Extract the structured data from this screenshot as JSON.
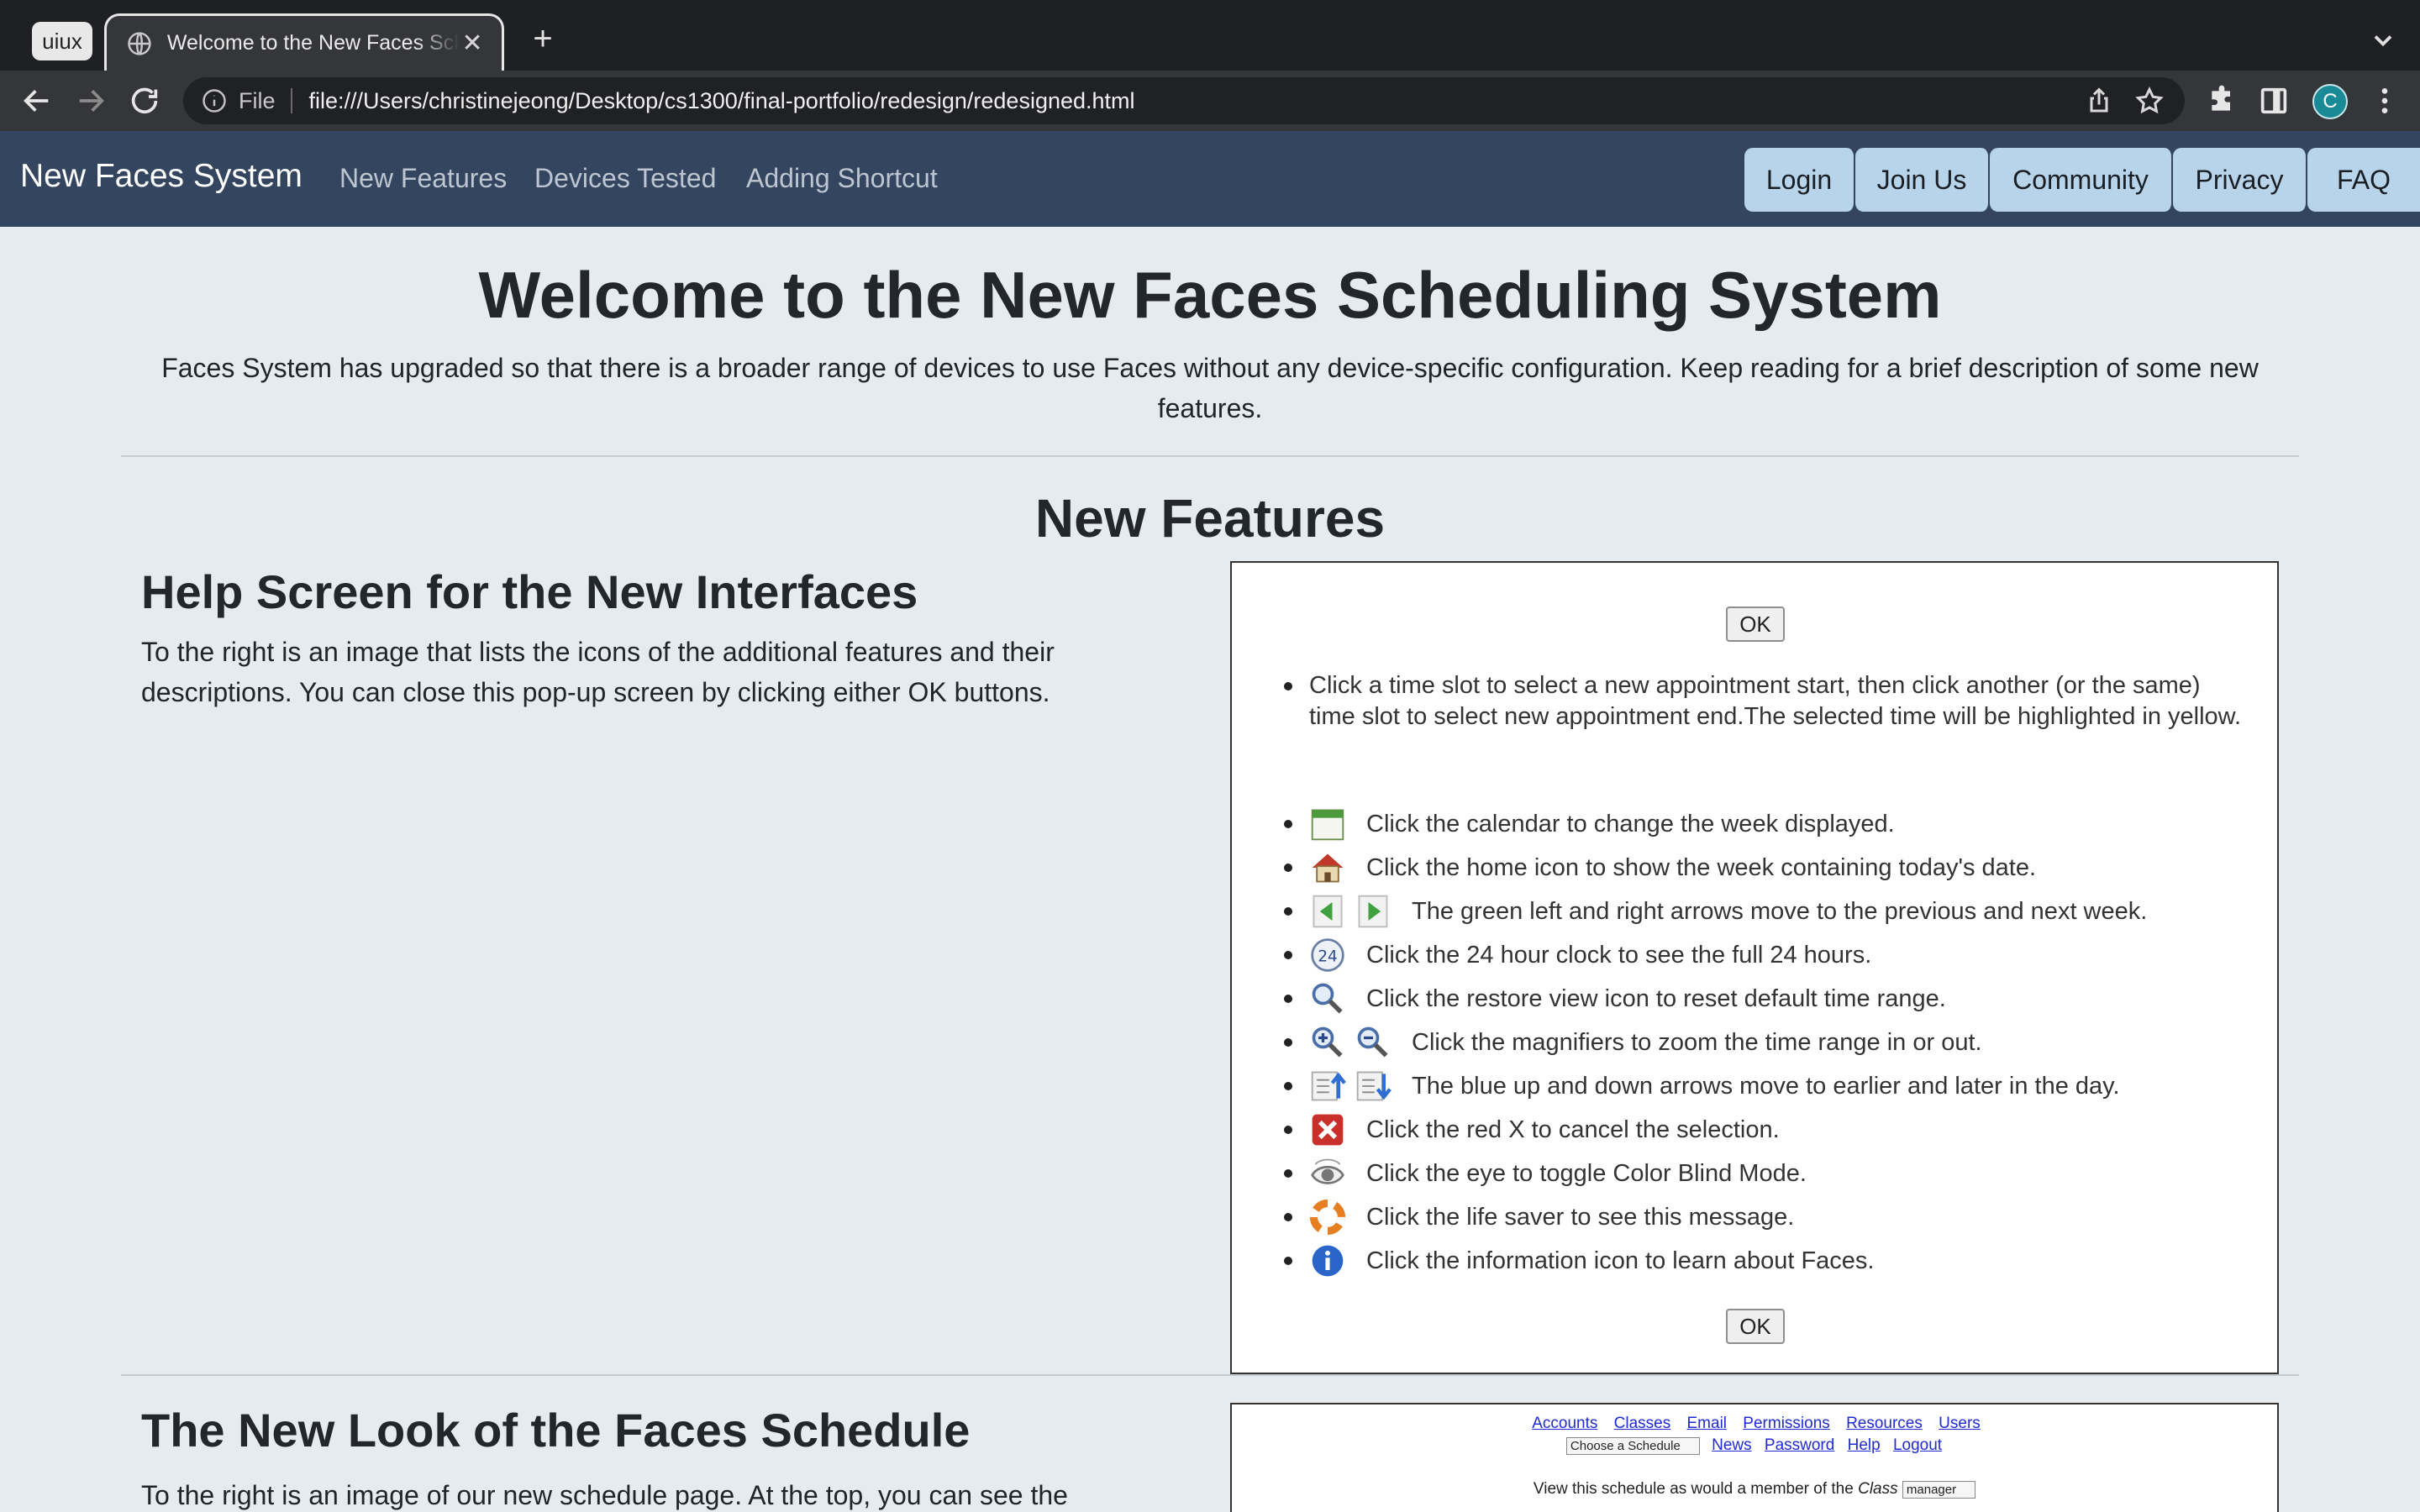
{
  "browser": {
    "profile_label": "uiux",
    "tab_title": "Welcome to the New Faces Scheduling System",
    "url_scheme": "File",
    "url": "file:///Users/christinejeong/Desktop/cs1300/final-portfolio/redesign/redesigned.html",
    "avatar_letter": "C"
  },
  "navbar": {
    "brand": "New Faces System",
    "links": [
      "New Features",
      "Devices Tested",
      "Adding Shortcut"
    ],
    "buttons": [
      "Login",
      "Join Us",
      "Community",
      "Privacy",
      "FAQ"
    ]
  },
  "hero": {
    "title": "Welcome to the New Faces Scheduling System",
    "subtitle": "Faces System has upgraded so that there is a broader range of devices to use Faces without any device-specific configuration. Keep reading for a brief description of some new features."
  },
  "new_features": {
    "heading": "New Features",
    "help": {
      "title": "Help Screen for the New Interfaces",
      "text": "To the right is an image that lists the icons of the additional features and their descriptions. You can close this pop-up screen by clicking either OK buttons.",
      "image": {
        "ok_label": "OK",
        "intro": "Click a time slot to select a new appointment start, then click another (or the same) time slot to select new appointment end.The selected time will be highlighted in yellow.",
        "items": [
          {
            "icons": [
              "calendar-icon"
            ],
            "text": "Click the calendar to change the week displayed."
          },
          {
            "icons": [
              "home-icon"
            ],
            "text": "Click the home icon to show the week containing today's date."
          },
          {
            "icons": [
              "arrow-left-icon",
              "arrow-right-icon"
            ],
            "text": "The green left and right arrows move to the previous and next week."
          },
          {
            "icons": [
              "clock-24-icon"
            ],
            "text": "Click the 24 hour clock to see the full 24 hours."
          },
          {
            "icons": [
              "restore-magnifier-icon"
            ],
            "text": "Click the restore view icon to reset default time range."
          },
          {
            "icons": [
              "zoom-in-icon",
              "zoom-out-icon"
            ],
            "text": "Click the magnifiers to zoom the time range in or out."
          },
          {
            "icons": [
              "arrow-up-icon",
              "arrow-down-icon"
            ],
            "text": "The blue up and down arrows move to earlier and later in the day."
          },
          {
            "icons": [
              "red-x-icon"
            ],
            "text": "Click the red X to cancel the selection."
          },
          {
            "icons": [
              "eye-icon"
            ],
            "text": "Click the eye to toggle Color Blind Mode."
          },
          {
            "icons": [
              "life-saver-icon"
            ],
            "text": "Click the life saver to see this message."
          },
          {
            "icons": [
              "info-icon"
            ],
            "text": "Click the information icon to learn about Faces."
          }
        ]
      }
    },
    "schedule": {
      "title": "The New Look of the Faces Schedule",
      "text": "To the right is an image of our new schedule page. At the top, you can see the",
      "image": {
        "links": [
          "Accounts",
          "Classes",
          "Email",
          "Permissions",
          "Resources",
          "Users"
        ],
        "select_label": "Choose a Schedule",
        "links2": [
          "News",
          "Password",
          "Help",
          "Logout"
        ],
        "view_text": "View this schedule as would a member of the",
        "view_class_word": "Class",
        "view_select": "manager"
      }
    }
  },
  "colors": {
    "navbar_bg": "#34465f",
    "nav_button_bg": "#b8d4ea",
    "page_bg": "#e5ebef"
  }
}
